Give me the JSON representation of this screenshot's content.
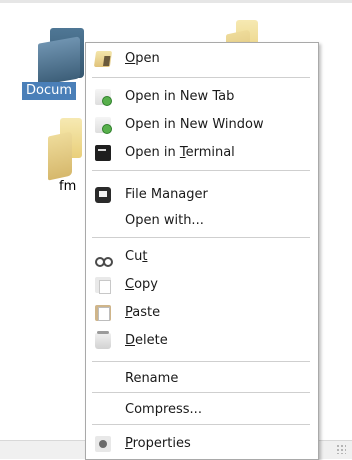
{
  "desktop": {
    "selected_icon_label": "Docum",
    "plain_icon_label": "fm"
  },
  "context_menu": {
    "items": [
      {
        "label": "Open",
        "icon": "open-folder-icon"
      },
      {
        "label": "Open in New Tab",
        "icon": "new-tab-icon"
      },
      {
        "label": "Open in New Window",
        "icon": "new-window-icon"
      },
      {
        "label": "Open in Terminal",
        "icon": "terminal-icon"
      },
      {
        "label": "File Manager",
        "icon": "file-manager-icon"
      },
      {
        "label": "Open with...",
        "icon": ""
      },
      {
        "label": "Cut",
        "icon": "cut-icon"
      },
      {
        "label": "Copy",
        "icon": "copy-icon"
      },
      {
        "label": "Paste",
        "icon": "paste-icon"
      },
      {
        "label": "Delete",
        "icon": "delete-icon"
      },
      {
        "label": "Rename",
        "icon": ""
      },
      {
        "label": "Compress...",
        "icon": ""
      },
      {
        "label": "Properties",
        "icon": "properties-icon"
      }
    ]
  }
}
